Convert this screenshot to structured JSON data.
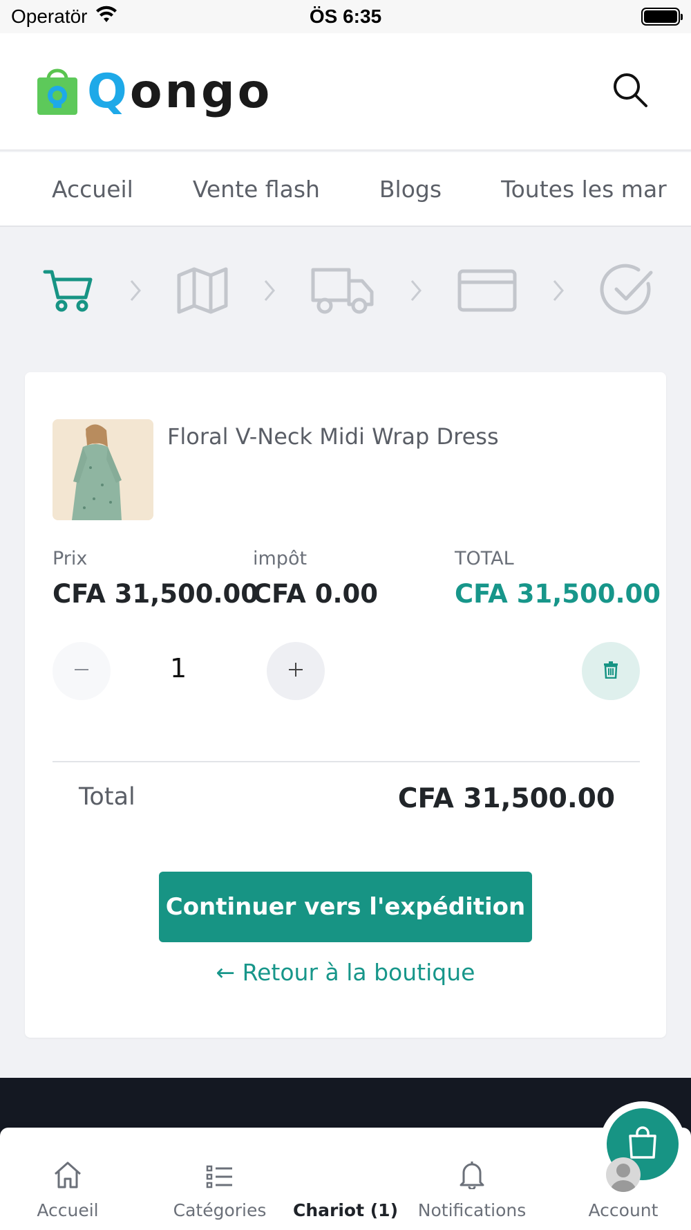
{
  "status_bar": {
    "carrier": "Operatör",
    "time": "ÖS 6:35"
  },
  "header": {
    "logo_text": "ongo",
    "logo_letter": "Q"
  },
  "nav": {
    "items": [
      "Accueil",
      "Vente flash",
      "Blogs",
      "Toutes les marques"
    ]
  },
  "steps": [
    "cart-icon",
    "map-icon",
    "truck-icon",
    "credit-card-icon",
    "check-circle-icon"
  ],
  "cart": {
    "product": {
      "name": "Floral V-Neck Midi Wrap Dress"
    },
    "price_label": "Prix",
    "price_value": "CFA 31,500.00",
    "tax_label": "impôt",
    "tax_value": "CFA 0.00",
    "total_label": "TOTAL",
    "total_value": "CFA 31,500.00",
    "quantity": "1",
    "summary_label": "Total",
    "summary_value": "CFA 31,500.00",
    "continue_label": "Continuer vers l'expédition",
    "back_label": "← Retour à la boutique"
  },
  "colors": {
    "accent": "#179484",
    "total_text": "#17968a"
  },
  "tabbar": {
    "home": "Accueil",
    "categories": "Catégories",
    "cart": "Chariot (1)",
    "notifications": "Notifications",
    "account": "Account"
  }
}
